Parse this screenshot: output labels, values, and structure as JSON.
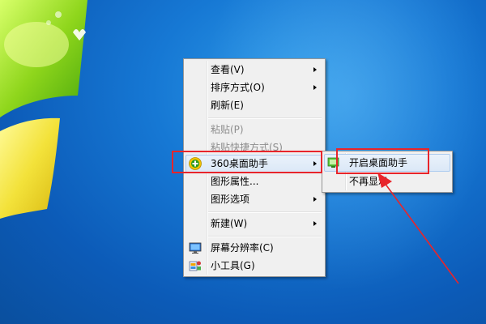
{
  "desktop": {
    "accent_color": "#1678d4",
    "highlight_color": "#e8252b"
  },
  "context_menu": {
    "items": [
      {
        "label": "查看(V)",
        "has_submenu": true,
        "disabled": false
      },
      {
        "label": "排序方式(O)",
        "has_submenu": true,
        "disabled": false
      },
      {
        "label": "刷新(E)",
        "has_submenu": false,
        "disabled": false
      },
      {
        "label": "粘贴(P)",
        "has_submenu": false,
        "disabled": true
      },
      {
        "label": "粘贴快捷方式(S)",
        "has_submenu": false,
        "disabled": true
      },
      {
        "label": "360桌面助手",
        "has_submenu": true,
        "disabled": false,
        "icon": "360-plus-icon",
        "highlighted": true
      },
      {
        "label": "图形属性...",
        "has_submenu": false,
        "disabled": false
      },
      {
        "label": "图形选项",
        "has_submenu": true,
        "disabled": false
      },
      {
        "label": "新建(W)",
        "has_submenu": true,
        "disabled": false
      },
      {
        "label": "屏幕分辨率(C)",
        "has_submenu": false,
        "disabled": false,
        "icon": "display-icon"
      },
      {
        "label": "小工具(G)",
        "has_submenu": false,
        "disabled": false,
        "icon": "gadgets-icon"
      }
    ]
  },
  "submenu": {
    "items": [
      {
        "label": "开启桌面助手",
        "highlighted": true,
        "icon": "desktop-helper-icon"
      },
      {
        "label": "不再显示",
        "highlighted": false
      }
    ]
  }
}
